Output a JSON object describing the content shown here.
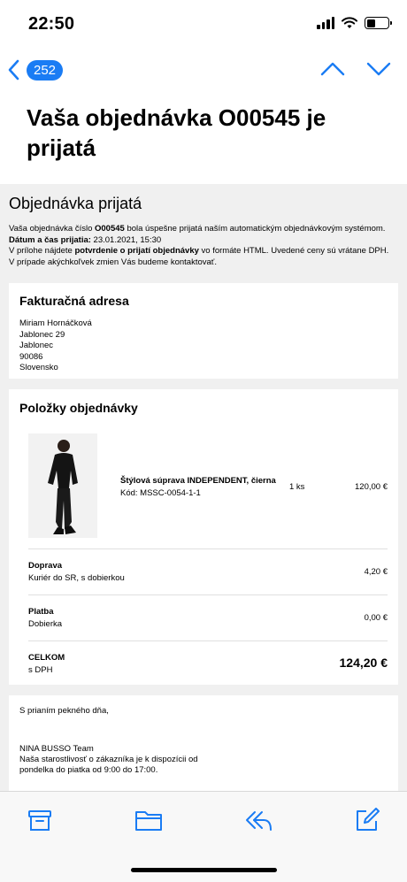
{
  "status_bar": {
    "time": "22:50"
  },
  "nav": {
    "unread_count": "252"
  },
  "email": {
    "subject": "Vaša objednávka O00545 je prijatá",
    "heading": "Objednávka prijatá",
    "intro": {
      "p1_before": "Vaša objednávka číslo ",
      "order_number": "O00545",
      "p1_after": " bola úspešne prijatá naším automatickým objednávkovým systémom.",
      "date_label": "Dátum a čas prijatia:",
      "date_value": " 23.01.2021, 15:30",
      "p2_before": "V prílohe nájdete ",
      "p2_bold": "potvrdenie o prijatí objednávky",
      "p2_after": " vo formáte HTML. Uvedené ceny sú vrátane DPH.",
      "p3": "V prípade akýchkoľvek zmien Vás budeme kontaktovať."
    },
    "billing": {
      "title": "Fakturačná adresa",
      "name": "Miriam Hornáčková",
      "street": "Jablonec 29",
      "city": "Jablonec",
      "zip": "90086",
      "country": "Slovensko"
    },
    "items": {
      "title": "Položky objednávky",
      "product": {
        "name": "Štýlová súprava INDEPENDENT, čierna",
        "code": "Kód: MSSC-0054-1-1",
        "qty": "1 ks",
        "price": "120,00 €"
      },
      "shipping": {
        "label": "Doprava",
        "desc": "Kuriér do SR, s dobierkou",
        "price": "4,20 €"
      },
      "payment": {
        "label": "Platba",
        "desc": "Dobierka",
        "price": "0,00 €"
      },
      "total": {
        "label": "CELKOM",
        "desc": "s DPH",
        "price": "124,20 €"
      }
    },
    "footer": {
      "greeting": "S prianím pekného dňa,",
      "team": "NINA BUSSO Team",
      "line1": "Naša starostlivosť o zákazníka je k dispozícii od",
      "line2": "pondelka do piatka od 9:00 do 17:00."
    }
  },
  "colors": {
    "accent": "#1a7cf4",
    "background": "#f0f0f0"
  },
  "icons": [
    "back-chevron-icon",
    "up-arrow-icon",
    "down-arrow-icon",
    "archive-icon",
    "folder-icon",
    "reply-icon",
    "compose-icon"
  ]
}
